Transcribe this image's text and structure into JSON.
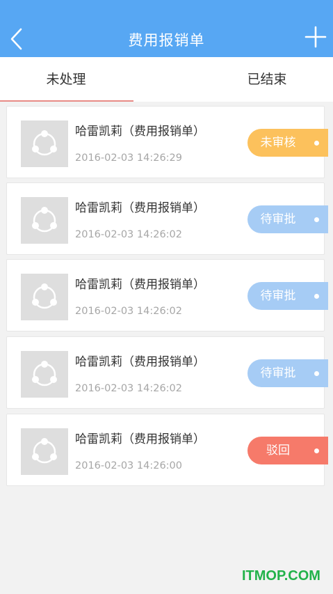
{
  "header": {
    "title": "费用报销单",
    "bg_color": "#57a7f3",
    "back_icon": "chevron-left-icon",
    "add_icon": "plus-icon"
  },
  "tabs": [
    {
      "label": "未处理",
      "active": true
    },
    {
      "label": "已结束",
      "active": false
    }
  ],
  "items": [
    {
      "title": "哈雷凯莉（费用报销单）",
      "time": "2016-02-03 14:26:29",
      "status": "未审核",
      "status_color": "#fcc15c"
    },
    {
      "title": "哈雷凯莉（费用报销单）",
      "time": "2016-02-03 14:26:02",
      "status": "待审批",
      "status_color": "#a6ccf5"
    },
    {
      "title": "哈雷凯莉（费用报销单）",
      "time": "2016-02-03 14:26:02",
      "status": "待审批",
      "status_color": "#a6ccf5"
    },
    {
      "title": "哈雷凯莉（费用报销单）",
      "time": "2016-02-03 14:26:02",
      "status": "待审批",
      "status_color": "#a6ccf5"
    },
    {
      "title": "哈雷凯莉（费用报销单）",
      "time": "2016-02-03 14:26:00",
      "status": "驳回",
      "status_color": "#f67a6a"
    }
  ],
  "watermark": "ITMOP.COM"
}
